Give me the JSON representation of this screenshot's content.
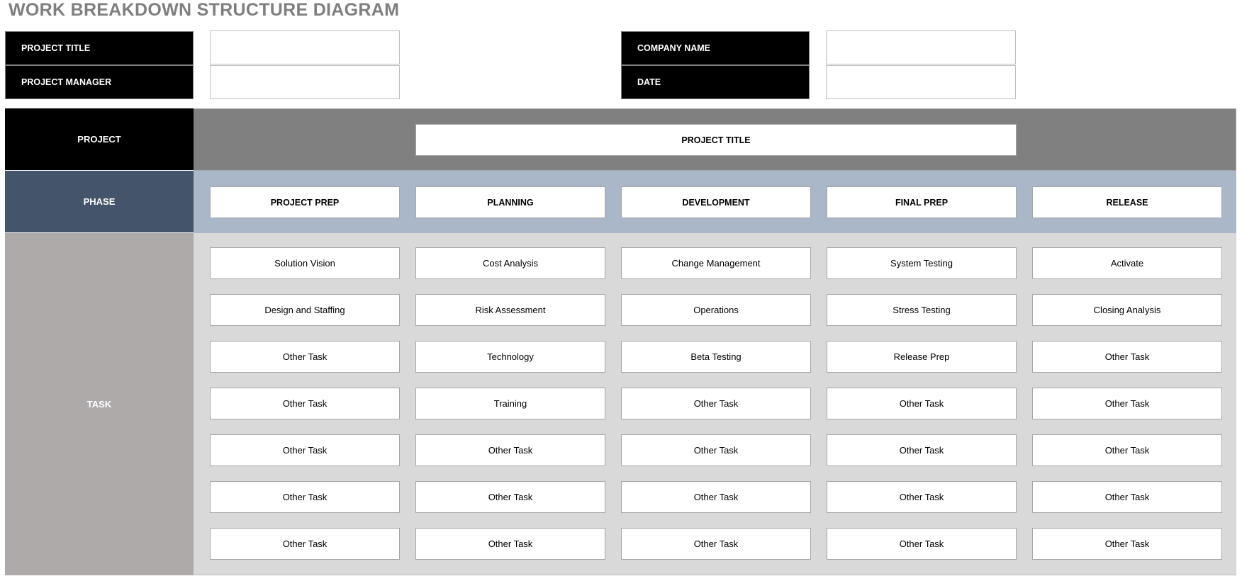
{
  "title": "WORK BREAKDOWN STRUCTURE DIAGRAM",
  "header": {
    "project_title_label": "PROJECT TITLE",
    "project_manager_label": "PROJECT MANAGER",
    "company_name_label": "COMPANY NAME",
    "date_label": "DATE",
    "project_title_value": "",
    "project_manager_value": "",
    "company_name_value": "",
    "date_value": ""
  },
  "rows": {
    "project_label": "PROJECT",
    "phase_label": "PHASE",
    "task_label": "TASK"
  },
  "project": {
    "title": "PROJECT TITLE"
  },
  "phases": [
    {
      "name": "PROJECT PREP",
      "tasks": [
        "Solution Vision",
        "Design and Staffing",
        "Other Task",
        "Other Task",
        "Other Task",
        "Other Task",
        "Other Task"
      ]
    },
    {
      "name": "PLANNING",
      "tasks": [
        "Cost Analysis",
        "Risk Assessment",
        "Technology",
        "Training",
        "Other Task",
        "Other Task",
        "Other Task"
      ]
    },
    {
      "name": "DEVELOPMENT",
      "tasks": [
        "Change Management",
        "Operations",
        "Beta Testing",
        "Other Task",
        "Other Task",
        "Other Task",
        "Other Task"
      ]
    },
    {
      "name": "FINAL PREP",
      "tasks": [
        "System Testing",
        "Stress Testing",
        "Release Prep",
        "Other Task",
        "Other Task",
        "Other Task",
        "Other Task"
      ]
    },
    {
      "name": "RELEASE",
      "tasks": [
        "Activate",
        "Closing Analysis",
        "Other Task",
        "Other Task",
        "Other Task",
        "Other Task",
        "Other Task"
      ]
    }
  ],
  "colors": {
    "project_band": "#808080",
    "phase_band": "#a9b7c9",
    "task_band": "#d9d9d9",
    "project_side": "#000000",
    "phase_side": "#44546a",
    "task_side": "#aeaaaa",
    "title_text": "#7f7f7f"
  }
}
